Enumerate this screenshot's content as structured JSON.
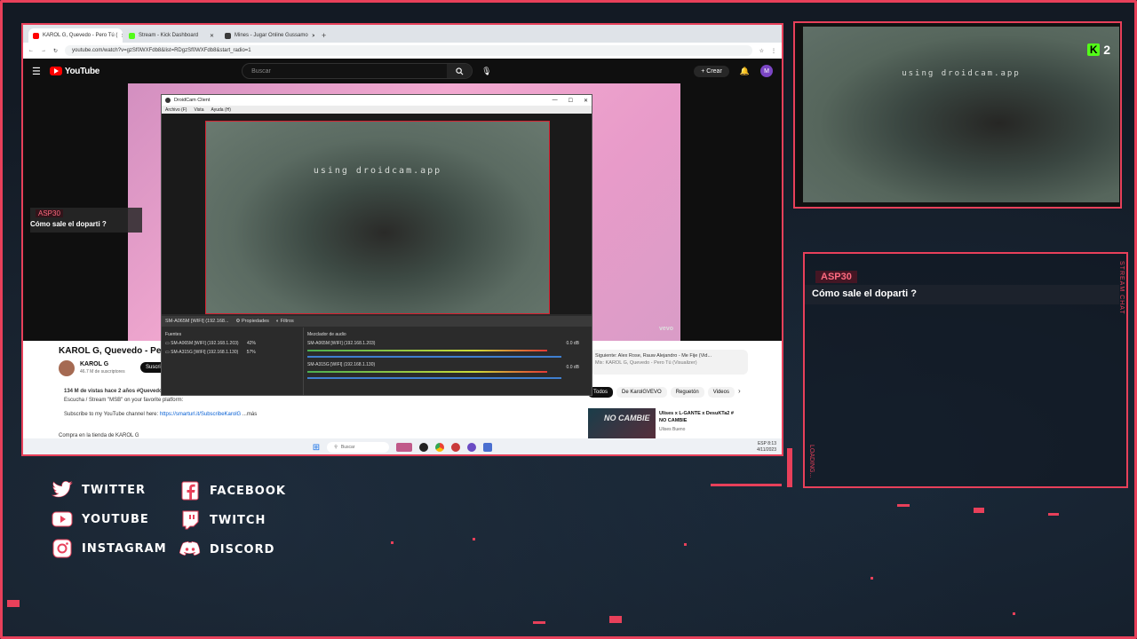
{
  "browser": {
    "tabs": [
      {
        "label": "KAROL G, Quevedo - Pero Tú (",
        "active": true,
        "color": "#ff0000"
      },
      {
        "label": "Stream - Kick Dashboard",
        "active": false,
        "color": "#53fc18"
      },
      {
        "label": "Mines - Jugar Online Gussamo",
        "active": false,
        "color": "#3a3a3a"
      }
    ],
    "new_tab": "+",
    "url": "youtube.com/watch?v=gzSf0WXFdb8&list=RDgzSf0WXFdb8&start_radio=1"
  },
  "youtube": {
    "logo": "YouTube",
    "search_placeholder": "Buscar",
    "create_label": "Crear",
    "avatar_letter": "M",
    "video_title": "KAROL G, Quevedo - Pero Tú",
    "channel_name": "KAROL G",
    "channel_subs": "46.7 M de suscriptores",
    "subscribe_label": "Suscri",
    "views_line": "134 M de vistas  hace 2 años  #Quevedo",
    "desc_line1": "Escucha / Stream \"MSB\" on your favorite platform:",
    "desc_line2_prefix": "Subscribe to my YouTube channel here:",
    "desc_link": "https://smarturl.it/SubscribeKarolG",
    "desc_more": "...más",
    "store": "Compra en la tienda de KAROL G",
    "vevo": "vevo",
    "next_label": "Siguiente: Alex Rose, Rauw Alejandro - Me Fije (Vid...",
    "next_sub": "Mix: KAROL G, Quevedo - Pero Tú (Visualizer)",
    "chips": [
      "Todos",
      "De KarolGVEVO",
      "Reguetón",
      "Videos"
    ],
    "rec_thumb_text": "NO CAMBIE",
    "rec_title": "Ulises x L-GANTE x DesuKTa2 # NO CAMBIE",
    "rec_channel": "Ulises Bueno"
  },
  "droidcam": {
    "title": "DroidCam Client",
    "menu": [
      "Archivo (F)",
      "Vista",
      "Ayuda (H)"
    ],
    "watermark": "using droidcam.app",
    "toolbar_source": "SM-A065M [WIFI] (192.168...",
    "toolbar_props": "Propiedades",
    "toolbar_filters": "Filtros",
    "sources_header": "Fuentes",
    "sources": [
      {
        "name": "SM-A065M [WIFI] (192.168.1.203)",
        "pct": "42%"
      },
      {
        "name": "SM-A315G [WIFI] (192.168.1.130)",
        "pct": "57%"
      }
    ],
    "mixer_header": "Mezclador de audio",
    "mixer": [
      {
        "name": "SM-A065M [WIFI] (192.168.1.203)",
        "db": "0.0 dB"
      },
      {
        "name": "SM-A315G [WIFI] (192.168.1.130)",
        "db": "0.0 dB"
      }
    ]
  },
  "taskbar": {
    "search": "Buscar",
    "lang": "ESP",
    "time": "8:13",
    "date": "4/11/2023"
  },
  "overlay_chat_small": {
    "user": "ASP30",
    "message": "Cómo sale el doparti ?"
  },
  "webcam": {
    "watermark": "using droidcam.app",
    "viewer_count": "2"
  },
  "chat_panel": {
    "user": "ASP30",
    "message": "Cómo sale el doparti ?",
    "side_label": "STREAM CHAT",
    "loading": "LOADING..."
  },
  "socials": [
    {
      "label": "TWITTER",
      "icon": "twitter-icon"
    },
    {
      "label": "FACEBOOK",
      "icon": "facebook-icon"
    },
    {
      "label": "YOUTUBE",
      "icon": "youtube-icon"
    },
    {
      "label": "TWITCH",
      "icon": "twitch-icon"
    },
    {
      "label": "INSTAGRAM",
      "icon": "instagram-icon"
    },
    {
      "label": "DISCORD",
      "icon": "discord-icon"
    }
  ],
  "colors": {
    "accent": "#e8405a",
    "kick_green": "#53fc18",
    "youtube_red": "#ff0000"
  }
}
